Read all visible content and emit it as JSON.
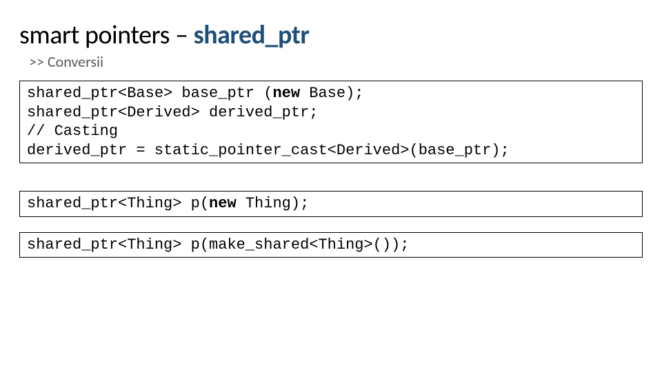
{
  "title_prefix": "smart pointers – ",
  "title_accent": "shared_ptr",
  "subtitle": ">> Conversii",
  "code_blocks": [
    {
      "lines": [
        [
          {
            "t": "shared_ptr<Base> base_ptr ("
          },
          {
            "t": "new",
            "kw": true
          },
          {
            "t": " Base);"
          }
        ],
        [
          {
            "t": "shared_ptr<Derived> derived_ptr;"
          }
        ],
        [
          {
            "t": "// Casting"
          }
        ],
        [
          {
            "t": "derived_ptr = static_pointer_cast<Derived>(base_ptr);"
          }
        ]
      ]
    },
    {
      "lines": [
        [
          {
            "t": "shared_ptr<Thing> p("
          },
          {
            "t": "new",
            "kw": true
          },
          {
            "t": " Thing);"
          }
        ]
      ]
    },
    {
      "lines": [
        [
          {
            "t": "shared_ptr<Thing> p(make_shared<Thing>());"
          }
        ]
      ]
    }
  ]
}
